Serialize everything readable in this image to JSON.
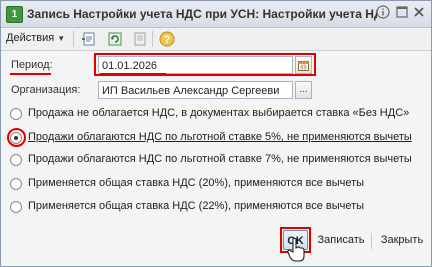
{
  "window": {
    "title": "Запись Настройки учета НДС при УСН: Настройки учета НДС...",
    "app_icon_letter": "1"
  },
  "toolbar": {
    "actions_label": "Действия"
  },
  "form": {
    "period_label": "Период:",
    "period_value": "01.01.2026",
    "org_label": "Организация:",
    "org_value": "ИП Васильев Александр Сергееви"
  },
  "options": [
    {
      "label": "Продажа не облагается НДС, в документах выбирается ставка «Без НДС»",
      "selected": false
    },
    {
      "label": "Продажи облагаются НДС по льготной ставке 5%, не применяются вычеты",
      "selected": true
    },
    {
      "label": "Продажи облагаются НДС по льготной ставке 7%, не применяются вычеты",
      "selected": false
    },
    {
      "label": "Применяется общая ставка НДС (20%), применяются все вычеты",
      "selected": false
    },
    {
      "label": "Применяется общая ставка НДС (22%), применяются все вычеты",
      "selected": false
    }
  ],
  "buttons": {
    "ok": "OK",
    "save": "Записать",
    "close": "Закрыть"
  },
  "colors": {
    "annotation": "#e00000",
    "title_bg": "#dfe5ec"
  }
}
